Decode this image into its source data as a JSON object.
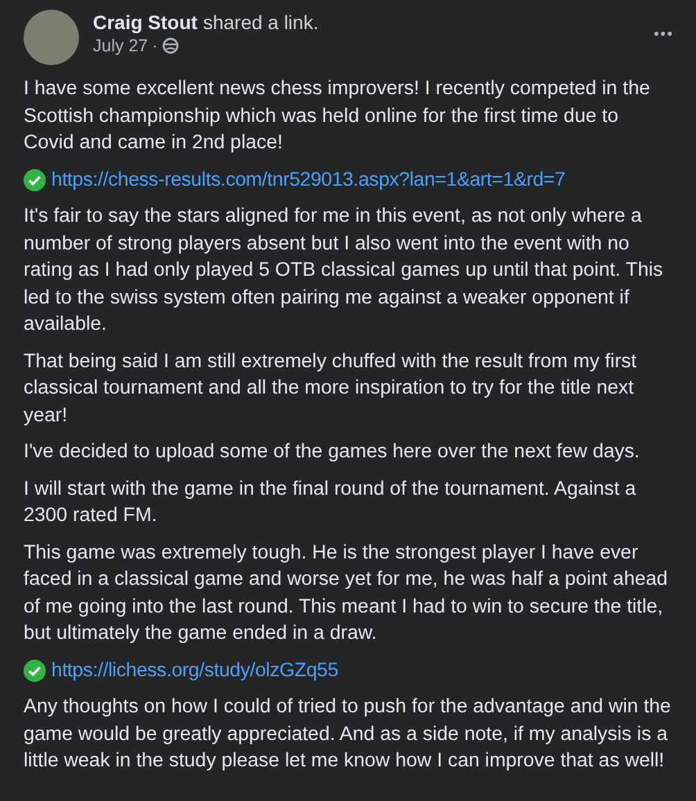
{
  "post": {
    "author": "Craig Stout",
    "action": "shared a link.",
    "date": "July 27",
    "separator": "·",
    "menu": "•••"
  },
  "body": [
    {
      "kind": "text",
      "text": "I have some excellent news chess improvers! I recently competed in the Scottish championship which was held online for the first time due to Covid and came in 2nd place!"
    },
    {
      "kind": "link",
      "text": "https://chess-results.com/tnr529013.aspx?lan=1&art=1&rd=7"
    },
    {
      "kind": "text",
      "text": "It's fair to say the stars aligned for me in this event, as not only where a number of strong players absent but I also went into the event with no rating as I had only played 5 OTB classical games up until that point. This led to the swiss system often pairing me against a weaker opponent if available."
    },
    {
      "kind": "text",
      "text": "That being said I am still extremely chuffed with the result from my first classical tournament and all the more inspiration to try for the title next year!"
    },
    {
      "kind": "text",
      "text": "I've decided to upload some of the games here over the next few days."
    },
    {
      "kind": "text",
      "text": "I will start with the game in the final round of the tournament. Against a 2300 rated FM."
    },
    {
      "kind": "text",
      "text": "This game was extremely tough. He is the strongest player I have ever faced in a classical game and worse yet for me, he was half a point ahead of me going into the last round. This meant I had to win to secure the title, but ultimately the game ended in a draw."
    },
    {
      "kind": "link",
      "text": "https://lichess.org/study/olzGZq55"
    },
    {
      "kind": "text",
      "text": "Any thoughts on how I could of tried to push for the advantage and win the game would be greatly appreciated. And as a side note, if my analysis is a little weak in the study please let me know how I can improve that as well!"
    }
  ]
}
